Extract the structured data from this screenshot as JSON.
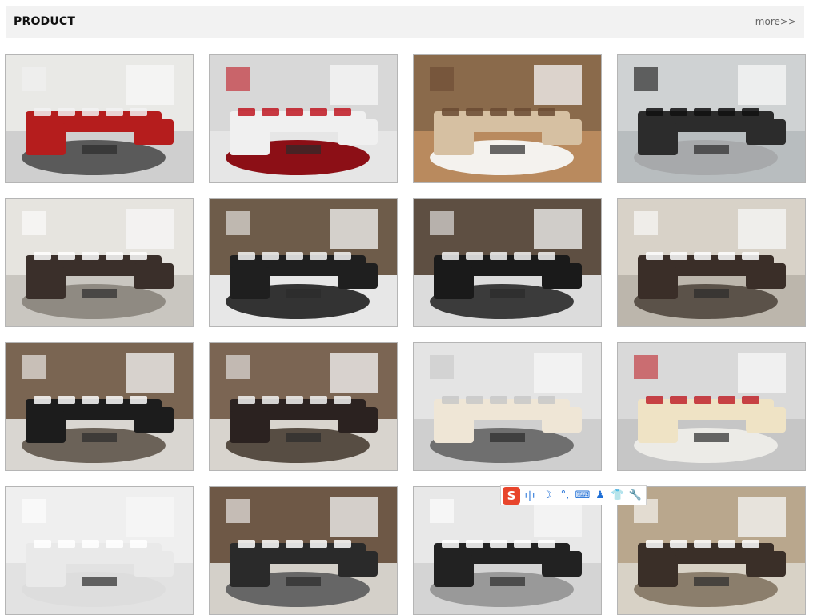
{
  "section": {
    "title": "PRODUCT",
    "more_label": "more>>"
  },
  "products": [
    {
      "icon": "red-white-sectional-sofa-photo",
      "palette": {
        "wall": "#e9e9e6",
        "floor": "#cfcfcf",
        "rug": "#5a5a5a",
        "sofa": "#b51d1d",
        "accent": "#f2f2f2"
      }
    },
    {
      "icon": "white-red-sectional-sofa-photo",
      "palette": {
        "wall": "#d8d8d8",
        "floor": "#e6e6e6",
        "rug": "#8c0f16",
        "sofa": "#f0f0f0",
        "accent": "#c01822"
      }
    },
    {
      "icon": "beige-leather-sectional-sofa-photo",
      "palette": {
        "wall": "#8a6a4b",
        "floor": "#b98a5e",
        "rug": "#f4f2ee",
        "sofa": "#d6c0a2",
        "accent": "#6a4a32"
      }
    },
    {
      "icon": "black-leather-sectional-sofa-photo",
      "palette": {
        "wall": "#cfd2d3",
        "floor": "#b8bdbf",
        "rug": "#a7a9ab",
        "sofa": "#2c2c2c",
        "accent": "#111111"
      }
    },
    {
      "icon": "dark-brown-sectional-sofa-photo",
      "palette": {
        "wall": "#e6e4df",
        "floor": "#c9c6c0",
        "rug": "#8f8a82",
        "sofa": "#3a2f2a",
        "accent": "#ffffff"
      }
    },
    {
      "icon": "black-white-u-shaped-sofa-photo",
      "palette": {
        "wall": "#6e5c4a",
        "floor": "#e7e7e7",
        "rug": "#333333",
        "sofa": "#1f1f1f",
        "accent": "#f5f5f5"
      }
    },
    {
      "icon": "black-u-shaped-sofa-photo",
      "palette": {
        "wall": "#5e4f42",
        "floor": "#dcdcdc",
        "rug": "#3b3b3b",
        "sofa": "#1a1a1a",
        "accent": "#f3f3f3"
      }
    },
    {
      "icon": "brown-corner-sofa-photo",
      "palette": {
        "wall": "#d8d2c8",
        "floor": "#bcb6ac",
        "rug": "#5b5249",
        "sofa": "#3a2e28",
        "accent": "#ffffff"
      }
    },
    {
      "icon": "black-white-sectional-sofa-photo",
      "palette": {
        "wall": "#7a6552",
        "floor": "#d9d6d1",
        "rug": "#6b6258",
        "sofa": "#1c1c1c",
        "accent": "#fbfbfb"
      }
    },
    {
      "icon": "dark-brown-sectional-with-fireplace-photo",
      "palette": {
        "wall": "#7b6553",
        "floor": "#d8d4ce",
        "rug": "#574d43",
        "sofa": "#2b2220",
        "accent": "#f2f2f2"
      }
    },
    {
      "icon": "cream-leather-sectional-sofa-photo",
      "palette": {
        "wall": "#e4e4e4",
        "floor": "#cfcfcf",
        "rug": "#6f6f6f",
        "sofa": "#efe6d6",
        "accent": "#c8c8c8"
      }
    },
    {
      "icon": "cream-sectional-red-pillows-photo",
      "palette": {
        "wall": "#d9d9d9",
        "floor": "#c6c6c6",
        "rug": "#ecebe7",
        "sofa": "#efe3c5",
        "accent": "#c0242b"
      }
    },
    {
      "icon": "sofa-photo-partial",
      "palette": {
        "wall": "#efefef",
        "floor": "#e2e2e2",
        "rug": "#dddddd",
        "sofa": "#e9e9e9",
        "accent": "#ffffff"
      }
    },
    {
      "icon": "sofa-photo-partial",
      "palette": {
        "wall": "#6e5846",
        "floor": "#d4d0c9",
        "rug": "#666666",
        "sofa": "#2a2a2a",
        "accent": "#ffffff"
      }
    },
    {
      "icon": "sofa-photo-partial",
      "palette": {
        "wall": "#e8e8e8",
        "floor": "#d4d4d4",
        "rug": "#999999",
        "sofa": "#222222",
        "accent": "#ffffff"
      }
    },
    {
      "icon": "sofa-photo-partial",
      "palette": {
        "wall": "#b9a78d",
        "floor": "#d8d2c6",
        "rug": "#8b7e6c",
        "sofa": "#3a2f28",
        "accent": "#ffffff"
      }
    }
  ],
  "ime_toolbar": {
    "logo": "S",
    "buttons": [
      {
        "icon": "chinese-input-mode-icon",
        "label": "中"
      },
      {
        "icon": "half-width-moon-icon",
        "label": "☽"
      },
      {
        "icon": "punctuation-icon",
        "label": "°,"
      },
      {
        "icon": "keyboard-icon",
        "label": "⌨"
      },
      {
        "icon": "user-icon",
        "label": "♟"
      },
      {
        "icon": "skin-shirt-icon",
        "label": "👕"
      },
      {
        "icon": "settings-wrench-icon",
        "label": "🔧"
      }
    ]
  }
}
